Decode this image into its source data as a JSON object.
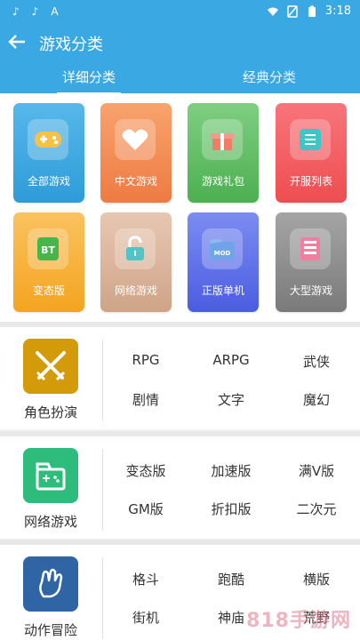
{
  "status": {
    "time": "3:18"
  },
  "header": {
    "title": "游戏分类"
  },
  "tabs": [
    {
      "label": "详细分类"
    },
    {
      "label": "经典分类"
    }
  ],
  "cards": [
    {
      "label": "全部游戏",
      "icon": "gamepad-icon",
      "color": "#3aa8e3"
    },
    {
      "label": "中文游戏",
      "icon": "heart-icon",
      "color": "#f1884f"
    },
    {
      "label": "游戏礼包",
      "icon": "gift-icon",
      "color": "#5cb85c"
    },
    {
      "label": "开服列表",
      "icon": "list-icon",
      "color": "#f45b5b"
    },
    {
      "label": "变态版",
      "icon": "bt-icon",
      "color": "#f6b83b"
    },
    {
      "label": "网络游戏",
      "icon": "unlock-icon",
      "color": "#dbb7a0"
    },
    {
      "label": "正版单机",
      "icon": "mod-icon",
      "color": "#5a6be6"
    },
    {
      "label": "大型游戏",
      "icon": "server-icon",
      "color": "#8e8e8e"
    }
  ],
  "sections": [
    {
      "title": "角色扮演",
      "icon": "swords-icon",
      "color": "#d39b0a",
      "items": [
        "RPG",
        "ARPG",
        "武侠",
        "剧情",
        "文字",
        "魔幻"
      ]
    },
    {
      "title": "网络游戏",
      "icon": "game-tab-icon",
      "color": "#2ebc7d",
      "items": [
        "变态版",
        "加速版",
        "满V版",
        "GM版",
        "折扣版",
        "二次元"
      ]
    },
    {
      "title": "动作冒险",
      "icon": "hand-icon",
      "color": "#2f65a4",
      "items": [
        "格斗",
        "跑酷",
        "横版",
        "街机",
        "神庙",
        "荒野"
      ]
    }
  ],
  "watermark": "818手游网"
}
